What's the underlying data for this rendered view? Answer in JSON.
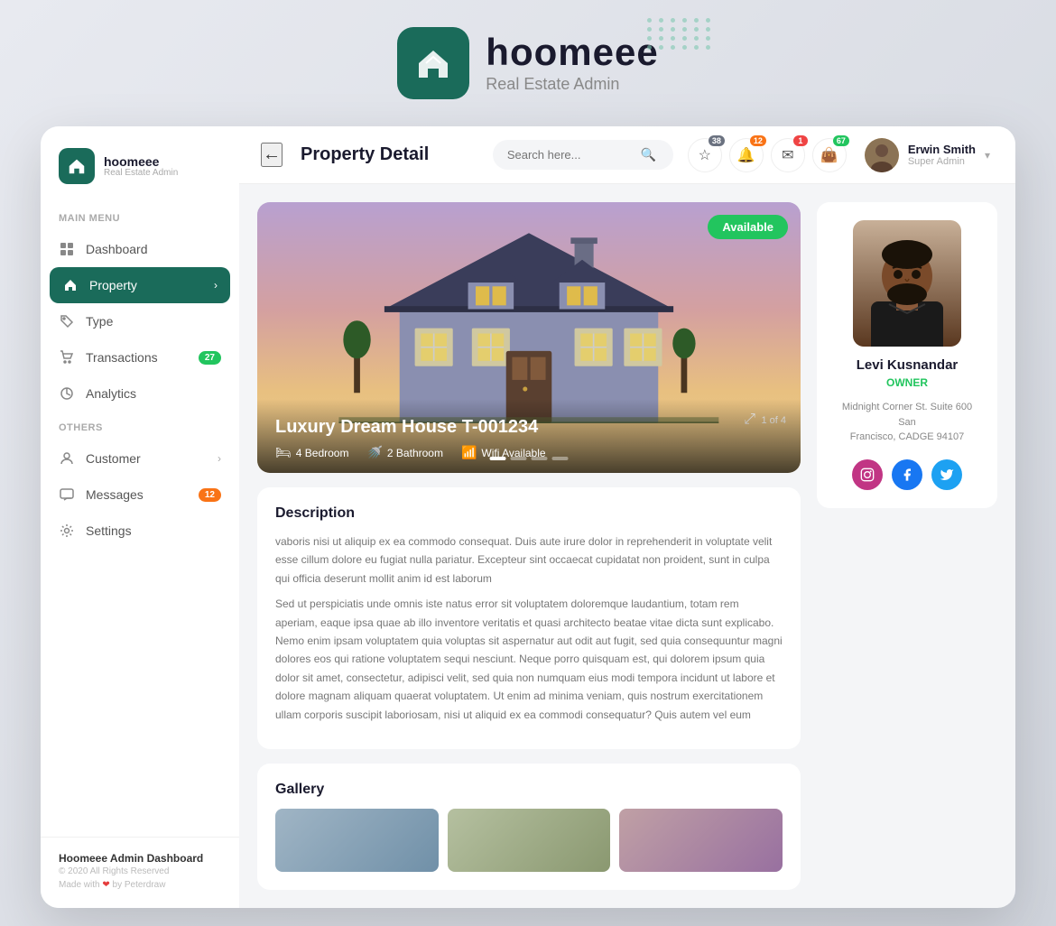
{
  "brand": {
    "logo_alt": "hoomeee logo",
    "name": "hoomeee",
    "subtitle": "Real Estate Admin"
  },
  "sidebar": {
    "brand_name": "hoomeee",
    "brand_sub": "Real Estate Admin",
    "main_menu_label": "Main Menu",
    "items": [
      {
        "id": "dashboard",
        "label": "Dashboard",
        "icon": "grid-icon",
        "active": false,
        "badge": null
      },
      {
        "id": "property",
        "label": "Property",
        "icon": "home-icon",
        "active": true,
        "badge": null,
        "has_arrow": true
      },
      {
        "id": "type",
        "label": "Type",
        "icon": "tag-icon",
        "active": false,
        "badge": null
      },
      {
        "id": "transactions",
        "label": "Transactions",
        "icon": "cart-icon",
        "active": false,
        "badge": "27"
      },
      {
        "id": "analytics",
        "label": "Analytics",
        "icon": "pie-icon",
        "active": false,
        "badge": null
      }
    ],
    "others_label": "Others",
    "others_items": [
      {
        "id": "customer",
        "label": "Customer",
        "icon": "person-icon",
        "active": false,
        "badge": null,
        "has_arrow": true
      },
      {
        "id": "messages",
        "label": "Messages",
        "icon": "chat-icon",
        "active": false,
        "badge": "12"
      },
      {
        "id": "settings",
        "label": "Settings",
        "icon": "gear-icon",
        "active": false,
        "badge": null
      }
    ],
    "footer_title": "Hoomeee Admin Dashboard",
    "footer_copy": "© 2020 All Rights Reserved",
    "footer_made": "Made with ❤ by Peterdraw"
  },
  "header": {
    "back_label": "←",
    "title": "Property Detail",
    "search_placeholder": "Search here...",
    "icons": [
      {
        "id": "star",
        "badge": "38",
        "badge_color": "gray"
      },
      {
        "id": "bell",
        "badge": "12",
        "badge_color": "orange"
      },
      {
        "id": "mail",
        "badge": "1",
        "badge_color": "red"
      },
      {
        "id": "bag",
        "badge": "67",
        "badge_color": "green"
      }
    ],
    "user_name": "Erwin Smith",
    "user_role": "Super Admin"
  },
  "property": {
    "status": "Available",
    "title": "Luxury Dream House T-001234",
    "features": [
      {
        "icon": "bed-icon",
        "label": "4 Bedroom"
      },
      {
        "icon": "bath-icon",
        "label": "2 Bathroom"
      },
      {
        "icon": "wifi-icon",
        "label": "Wifi Available"
      }
    ],
    "image_counter": "1 of 4",
    "description_title": "Description",
    "description_p1": "vaboris nisi ut aliquip ex ea commodo consequat. Duis aute irure dolor in reprehenderit in voluptate velit esse cillum dolore eu fugiat nulla pariatur. Excepteur sint occaecat cupidatat non proident, sunt in culpa qui officia deserunt mollit anim id est laborum",
    "description_p2": "Sed ut perspiciatis unde omnis iste natus error sit voluptatem doloremque laudantium, totam rem aperiam, eaque ipsa quae ab illo inventore veritatis et quasi architecto beatae vitae dicta sunt explicabo. Nemo enim ipsam voluptatem quia voluptas sit aspernatur aut odit aut fugit, sed quia consequuntur magni dolores eos qui ratione voluptatem sequi nesciunt. Neque porro quisquam est, qui dolorem ipsum quia dolor sit amet, consectetur, adipisci velit, sed quia non numquam eius modi tempora incidunt ut labore et dolore magnam aliquam quaerat voluptatem. Ut enim ad minima veniam, quis nostrum exercitationem ullam corporis suscipit laboriosam, nisi ut aliquid ex ea commodi consequatur? Quis autem vel eum",
    "gallery_title": "Gallery"
  },
  "agent": {
    "name": "Levi Kusnandar",
    "role": "OWNER",
    "address_line1": "Midnight Corner St. Suite 600 San",
    "address_line2": "Francisco, CADGE 94107",
    "socials": [
      "instagram",
      "facebook",
      "twitter"
    ]
  }
}
